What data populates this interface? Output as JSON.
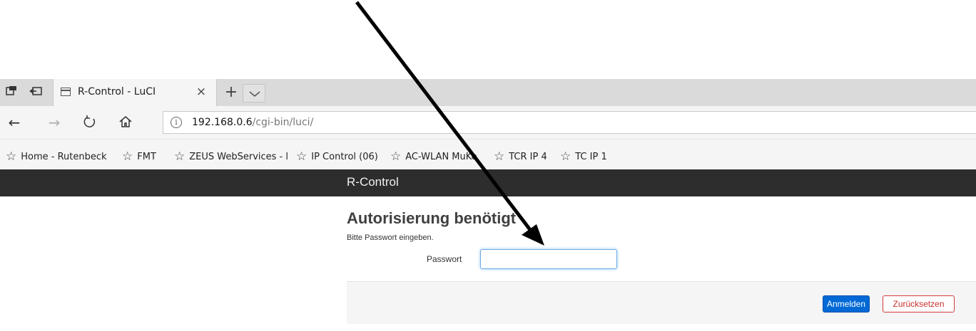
{
  "browser": {
    "tab_title": "R-Control - LuCI",
    "url_host": "192.168.0.6",
    "url_path": "/cgi-bin/luci/",
    "favorites": [
      "Home  - Rutenbeck",
      "FMT",
      "ZEUS WebServices - l",
      "IP Control (06)",
      "AC-WLAN MuKo",
      "TCR IP 4",
      "TC IP 1"
    ]
  },
  "page": {
    "brand": "R-Control",
    "heading": "Autorisierung benötigt",
    "description": "Bitte Passwort eingeben.",
    "password_label": "Passwort",
    "password_value": "",
    "login_button": "Anmelden",
    "reset_button": "Zurücksetzen"
  },
  "colors": {
    "header_bg": "#2d2d2d",
    "primary_button": "#0069d6",
    "reset_border": "#d23b3b",
    "annotation_arrow": "#000000"
  },
  "icons": [
    "tab-aside-icon",
    "tab-back-icon",
    "page-icon",
    "close-icon",
    "plus-icon",
    "chevron-down-icon",
    "back-arrow-icon",
    "forward-arrow-icon",
    "refresh-icon",
    "home-icon",
    "info-icon",
    "star-icon"
  ]
}
